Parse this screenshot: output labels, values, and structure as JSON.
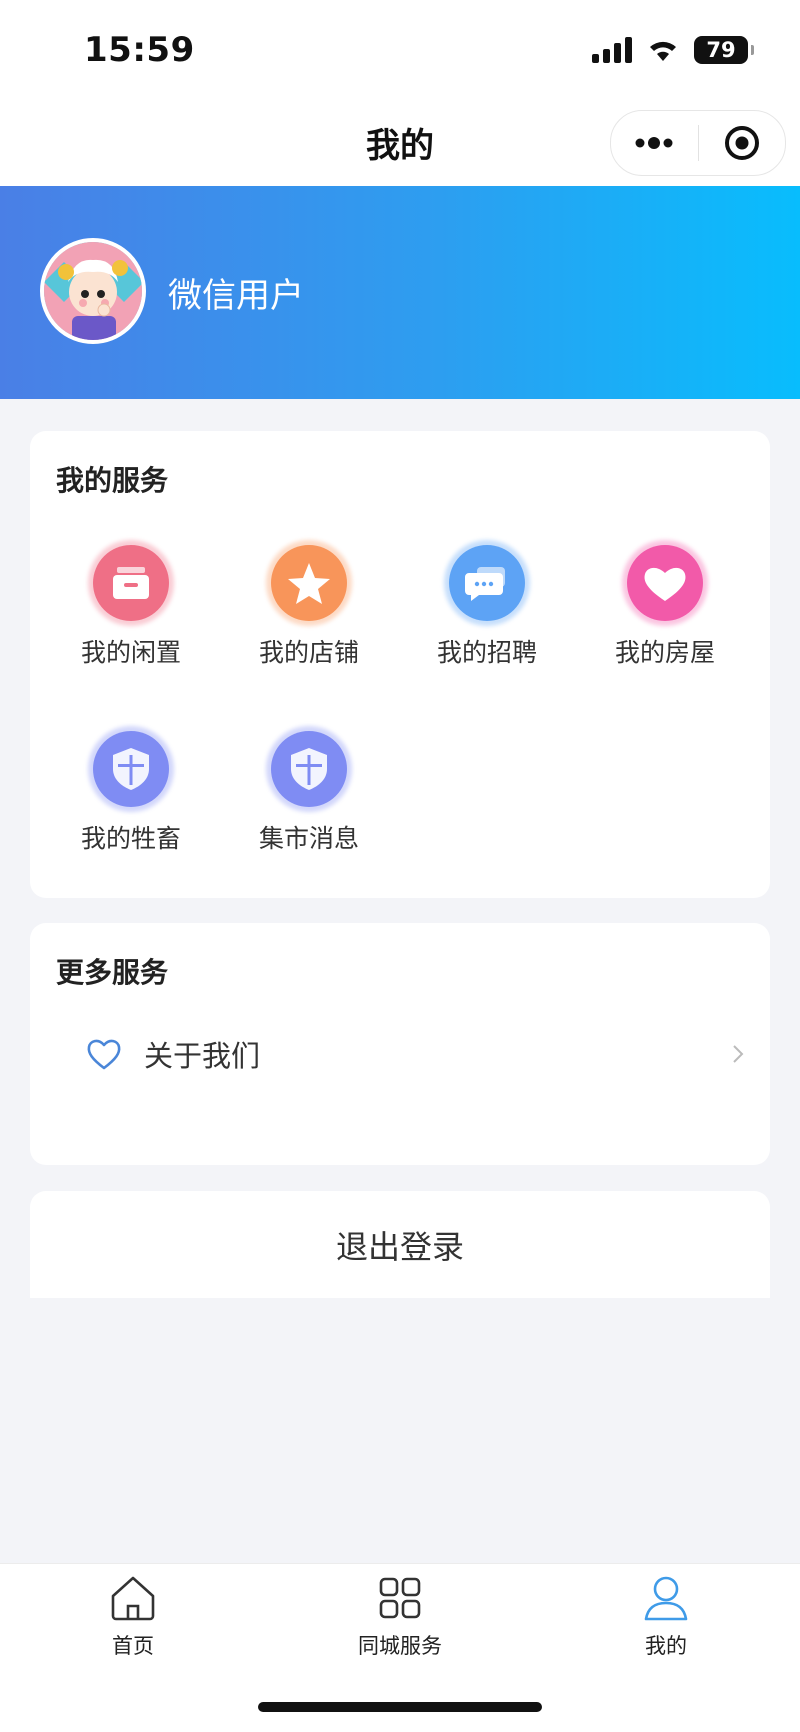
{
  "status_bar": {
    "time": "15:59",
    "battery": "79"
  },
  "nav": {
    "title": "我的"
  },
  "profile": {
    "username": "微信用户"
  },
  "my_services": {
    "title": "我的服务",
    "items": [
      {
        "label": "我的闲置",
        "icon": "drawer-icon",
        "color": "#ef6f86"
      },
      {
        "label": "我的店铺",
        "icon": "star-icon",
        "color": "#f8955a"
      },
      {
        "label": "我的招聘",
        "icon": "chat-icon",
        "color": "#5da3f5"
      },
      {
        "label": "我的房屋",
        "icon": "heart-icon",
        "color": "#f25aa9"
      },
      {
        "label": "我的牲畜",
        "icon": "shield-icon",
        "color": "#7f8cf3"
      },
      {
        "label": "集市消息",
        "icon": "shield-icon",
        "color": "#7f8cf3"
      }
    ]
  },
  "more_services": {
    "title": "更多服务",
    "items": [
      {
        "label": "关于我们",
        "icon": "heart-outline-icon"
      }
    ]
  },
  "logout": {
    "label": "退出登录"
  },
  "tabbar": {
    "items": [
      {
        "label": "首页",
        "icon": "home-icon"
      },
      {
        "label": "同城服务",
        "icon": "grid-icon"
      },
      {
        "label": "我的",
        "icon": "user-icon",
        "active": true
      }
    ],
    "active_color": "#3f9be8"
  }
}
